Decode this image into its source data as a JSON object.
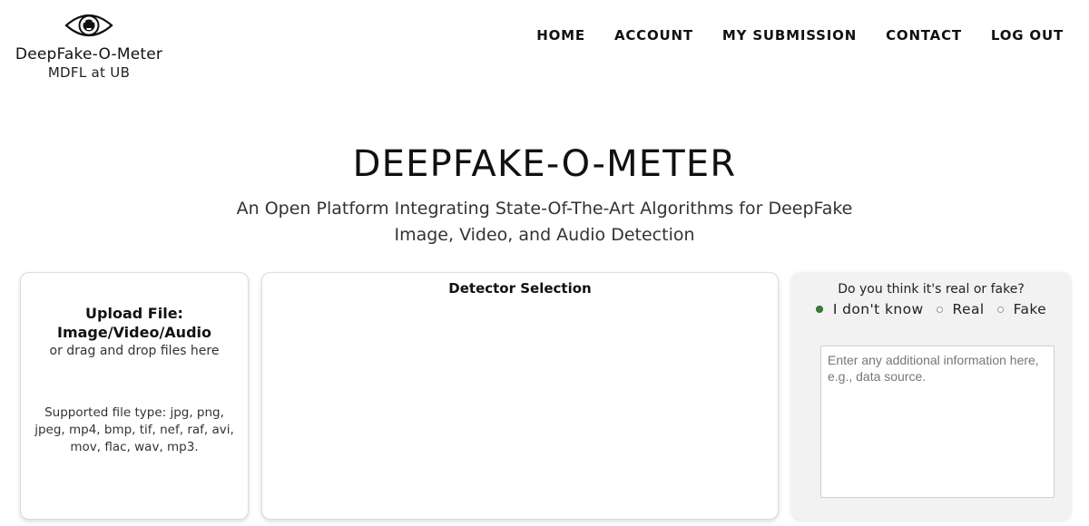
{
  "header": {
    "logo_name": "DeepFake-O-Meter",
    "logo_sub": "MDFL at UB",
    "logo_icon": "eye-icon",
    "nav": [
      "HOME",
      "ACCOUNT",
      "MY SUBMISSION",
      "CONTACT",
      "LOG OUT"
    ]
  },
  "hero": {
    "title": "DEEPFAKE-O-METER",
    "subtitle_line1": "An Open Platform Integrating State-Of-The-Art Algorithms for DeepFake",
    "subtitle_line2": "Image, Video, and Audio Detection"
  },
  "upload": {
    "title_line1": "Upload File:",
    "title_line2": "Image/Video/Audio",
    "hint": "or drag and drop files here",
    "types": "Supported file type: jpg, png, jpeg, mp4, bmp, tif, nef, raf, avi, mov, flac, wav, mp3."
  },
  "detector": {
    "title": "Detector Selection"
  },
  "feedback": {
    "question": "Do you think it's real or fake?",
    "options": [
      "I don't know",
      "Real",
      "Fake"
    ],
    "selected": "I don't know",
    "placeholder": "Enter any additional information here, e.g., data source.",
    "value": ""
  },
  "colors": {
    "radio_selected": "#3b7d3b",
    "feedback_bg": "#f2f2f2"
  }
}
